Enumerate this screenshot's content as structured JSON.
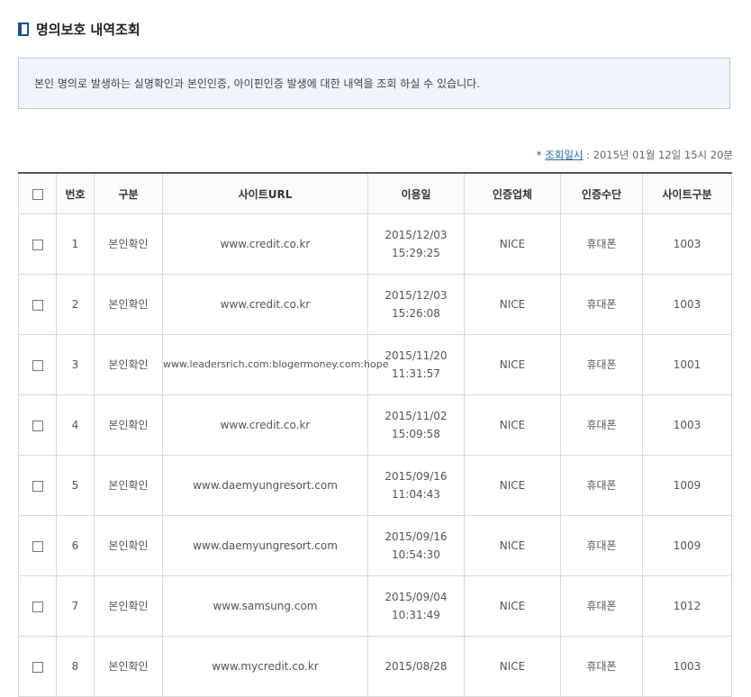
{
  "header": {
    "title": "명의보호 내역조회",
    "icon": "book-icon"
  },
  "notice": {
    "text": "본인 명의로 발생하는 실명확인과 본인인증, 아이핀인증 발생에 대한 내역을 조회 하실 수 있습니다."
  },
  "query_time": {
    "marker": "*",
    "label": "조회일시",
    "value": " : 2015년 01월 12일 15시 20분"
  },
  "table": {
    "columns": [
      "번호",
      "구분",
      "사이트URL",
      "이용일",
      "인증업체",
      "인증수단",
      "사이트구분"
    ],
    "rows": [
      {
        "no": "1",
        "type": "본인확인",
        "url": "www.credit.co.kr",
        "date": "2015/12/03",
        "time": "15:29:25",
        "vendor": "NICE",
        "method": "휴대폰",
        "site_code": "1003"
      },
      {
        "no": "2",
        "type": "본인확인",
        "url": "www.credit.co.kr",
        "date": "2015/12/03",
        "time": "15:26:08",
        "vendor": "NICE",
        "method": "휴대폰",
        "site_code": "1003"
      },
      {
        "no": "3",
        "type": "본인확인",
        "url": "www.leadersrich.com:blogermoney.com:hope",
        "date": "2015/11/20",
        "time": "11:31:57",
        "vendor": "NICE",
        "method": "휴대폰",
        "site_code": "1001"
      },
      {
        "no": "4",
        "type": "본인확인",
        "url": "www.credit.co.kr",
        "date": "2015/11/02",
        "time": "15:09:58",
        "vendor": "NICE",
        "method": "휴대폰",
        "site_code": "1003"
      },
      {
        "no": "5",
        "type": "본인확인",
        "url": "www.daemyungresort.com",
        "date": "2015/09/16",
        "time": "11:04:43",
        "vendor": "NICE",
        "method": "휴대폰",
        "site_code": "1009"
      },
      {
        "no": "6",
        "type": "본인확인",
        "url": "www.daemyungresort.com",
        "date": "2015/09/16",
        "time": "10:54:30",
        "vendor": "NICE",
        "method": "휴대폰",
        "site_code": "1009"
      },
      {
        "no": "7",
        "type": "본인확인",
        "url": "www.samsung.com",
        "date": "2015/09/04",
        "time": "10:31:49",
        "vendor": "NICE",
        "method": "휴대폰",
        "site_code": "1012"
      },
      {
        "no": "8",
        "type": "본인확인",
        "url": "www.mycredit.co.kr",
        "date": "2015/08/28",
        "time": "",
        "vendor": "NICE",
        "method": "휴대폰",
        "site_code": "1003"
      }
    ]
  }
}
